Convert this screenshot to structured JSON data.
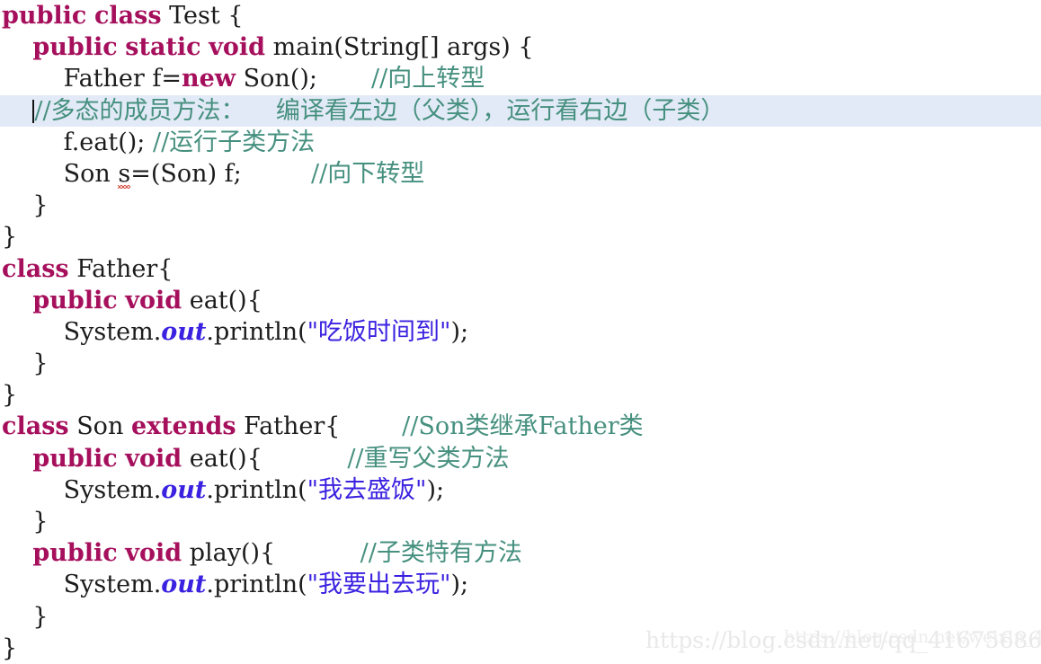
{
  "editor": {
    "language": "java",
    "colors": {
      "background": "#ffffff",
      "keyword": "#a50f5c",
      "identifier": "#1c1c1c",
      "comment": "#46907f",
      "string": "#3a22e0",
      "static_field": "#3a22e0",
      "current_line_highlight": "#e3eaf7",
      "error_underline": "#d03a2a",
      "caret": "#131313",
      "watermark": "#e9e9e9"
    },
    "current_line_number": 4,
    "caret_line_index": 3
  },
  "code": {
    "lines": [
      {
        "index": 0,
        "highlighted": false,
        "tokens": [
          {
            "t": "public",
            "c": "kw"
          },
          {
            "t": " ",
            "c": "pun"
          },
          {
            "t": "class",
            "c": "kw"
          },
          {
            "t": " ",
            "c": "pun"
          },
          {
            "t": "Test",
            "c": "id"
          },
          {
            "t": " {",
            "c": "pun"
          }
        ]
      },
      {
        "index": 1,
        "highlighted": false,
        "tokens": [
          {
            "t": "    ",
            "c": "pun"
          },
          {
            "t": "public",
            "c": "kw"
          },
          {
            "t": " ",
            "c": "pun"
          },
          {
            "t": "static",
            "c": "kw"
          },
          {
            "t": " ",
            "c": "pun"
          },
          {
            "t": "void",
            "c": "kw"
          },
          {
            "t": " ",
            "c": "pun"
          },
          {
            "t": "main(String[] args) {",
            "c": "id"
          }
        ]
      },
      {
        "index": 2,
        "highlighted": false,
        "tokens": [
          {
            "t": "        ",
            "c": "pun"
          },
          {
            "t": "Father f=",
            "c": "id"
          },
          {
            "t": "new",
            "c": "kw"
          },
          {
            "t": " ",
            "c": "pun"
          },
          {
            "t": "Son();",
            "c": "id"
          },
          {
            "t": "       ",
            "c": "pun"
          },
          {
            "t": "//向上转型",
            "c": "cmt"
          }
        ]
      },
      {
        "index": 3,
        "highlighted": true,
        "caret": true,
        "tokens": [
          {
            "t": "    ",
            "c": "pun"
          },
          {
            "t": "//多态的成员方法：    编译看左边（父类），运行看右边（子类）",
            "c": "cmt"
          }
        ]
      },
      {
        "index": 4,
        "highlighted": false,
        "tokens": [
          {
            "t": "        ",
            "c": "pun"
          },
          {
            "t": "f.eat();",
            "c": "id"
          },
          {
            "t": " ",
            "c": "pun"
          },
          {
            "t": "//运行子类方法",
            "c": "cmt"
          }
        ]
      },
      {
        "index": 5,
        "highlighted": false,
        "tokens": [
          {
            "t": "        ",
            "c": "pun"
          },
          {
            "t": "Son ",
            "c": "id"
          },
          {
            "t": "s",
            "c": "id",
            "squiggle": true
          },
          {
            "t": "=(Son) f;",
            "c": "id"
          },
          {
            "t": "         ",
            "c": "pun"
          },
          {
            "t": "//向下转型",
            "c": "cmt"
          }
        ]
      },
      {
        "index": 6,
        "highlighted": false,
        "tokens": [
          {
            "t": "    }",
            "c": "pun"
          }
        ]
      },
      {
        "index": 7,
        "highlighted": false,
        "tokens": [
          {
            "t": "}",
            "c": "pun"
          }
        ]
      },
      {
        "index": 8,
        "highlighted": false,
        "tokens": [
          {
            "t": "class",
            "c": "kw"
          },
          {
            "t": " ",
            "c": "pun"
          },
          {
            "t": "Father{",
            "c": "id"
          }
        ]
      },
      {
        "index": 9,
        "highlighted": false,
        "tokens": [
          {
            "t": "    ",
            "c": "pun"
          },
          {
            "t": "public",
            "c": "kw"
          },
          {
            "t": " ",
            "c": "pun"
          },
          {
            "t": "void",
            "c": "kw"
          },
          {
            "t": " ",
            "c": "pun"
          },
          {
            "t": "eat(){",
            "c": "id"
          }
        ]
      },
      {
        "index": 10,
        "highlighted": false,
        "tokens": [
          {
            "t": "        ",
            "c": "pun"
          },
          {
            "t": "System.",
            "c": "id"
          },
          {
            "t": "out",
            "c": "fld"
          },
          {
            "t": ".println(",
            "c": "id"
          },
          {
            "t": "\"吃饭时间到\"",
            "c": "str"
          },
          {
            "t": ");",
            "c": "id"
          }
        ]
      },
      {
        "index": 11,
        "highlighted": false,
        "tokens": [
          {
            "t": "    }",
            "c": "pun"
          }
        ]
      },
      {
        "index": 12,
        "highlighted": false,
        "tokens": [
          {
            "t": "}",
            "c": "pun"
          }
        ]
      },
      {
        "index": 13,
        "highlighted": false,
        "tokens": [
          {
            "t": "class",
            "c": "kw"
          },
          {
            "t": " ",
            "c": "pun"
          },
          {
            "t": "Son",
            "c": "id"
          },
          {
            "t": " ",
            "c": "pun"
          },
          {
            "t": "extends",
            "c": "kw"
          },
          {
            "t": " ",
            "c": "pun"
          },
          {
            "t": "Father{",
            "c": "id"
          },
          {
            "t": "        ",
            "c": "pun"
          },
          {
            "t": "//Son类继承Father类",
            "c": "cmt"
          }
        ]
      },
      {
        "index": 14,
        "highlighted": false,
        "tokens": [
          {
            "t": "    ",
            "c": "pun"
          },
          {
            "t": "public",
            "c": "kw"
          },
          {
            "t": " ",
            "c": "pun"
          },
          {
            "t": "void",
            "c": "kw"
          },
          {
            "t": " ",
            "c": "pun"
          },
          {
            "t": "eat(){",
            "c": "id"
          },
          {
            "t": "           ",
            "c": "pun"
          },
          {
            "t": "//重写父类方法",
            "c": "cmt"
          }
        ]
      },
      {
        "index": 15,
        "highlighted": false,
        "tokens": [
          {
            "t": "        ",
            "c": "pun"
          },
          {
            "t": "System.",
            "c": "id"
          },
          {
            "t": "out",
            "c": "fld"
          },
          {
            "t": ".println(",
            "c": "id"
          },
          {
            "t": "\"我去盛饭\"",
            "c": "str"
          },
          {
            "t": ");",
            "c": "id"
          }
        ]
      },
      {
        "index": 16,
        "highlighted": false,
        "tokens": [
          {
            "t": "    }",
            "c": "pun"
          }
        ]
      },
      {
        "index": 17,
        "highlighted": false,
        "tokens": [
          {
            "t": "    ",
            "c": "pun"
          },
          {
            "t": "public",
            "c": "kw"
          },
          {
            "t": " ",
            "c": "pun"
          },
          {
            "t": "void",
            "c": "kw"
          },
          {
            "t": " ",
            "c": "pun"
          },
          {
            "t": "play(){",
            "c": "id"
          },
          {
            "t": "           ",
            "c": "pun"
          },
          {
            "t": "//子类特有方法",
            "c": "cmt"
          }
        ]
      },
      {
        "index": 18,
        "highlighted": false,
        "tokens": [
          {
            "t": "        ",
            "c": "pun"
          },
          {
            "t": "System.",
            "c": "id"
          },
          {
            "t": "out",
            "c": "fld"
          },
          {
            "t": ".println(",
            "c": "id"
          },
          {
            "t": "\"我要出去玩\"",
            "c": "str"
          },
          {
            "t": ");",
            "c": "id"
          }
        ]
      },
      {
        "index": 19,
        "highlighted": false,
        "tokens": [
          {
            "t": "    }",
            "c": "pun"
          }
        ]
      },
      {
        "index": 20,
        "highlighted": false,
        "tokens": [
          {
            "t": "}",
            "c": "pun"
          }
        ]
      }
    ]
  },
  "watermarks": {
    "primary": "https://blog.csdn.net/qq_41675686",
    "secondary": "https://blog.csdn.net/weixin_43731634"
  }
}
